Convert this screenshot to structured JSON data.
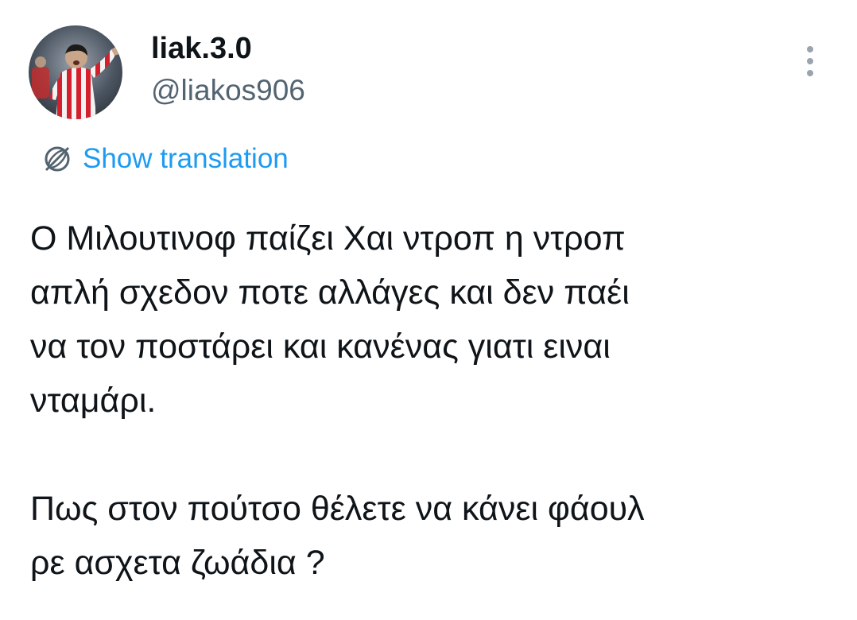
{
  "author": {
    "display_name": "liak.3.0",
    "handle": "@liakos906",
    "avatar_icon": "profile-photo-footballer-red-white-stripes"
  },
  "actions": {
    "more_icon": "vertical-ellipsis-icon"
  },
  "translation": {
    "label": "Show translation",
    "icon": "translate-globe-icon"
  },
  "tweet": {
    "text": "Ο Μιλουτινοφ παίζει Χαι ντροπ η ντροπ\nαπλή σχεδον ποτε αλλάγες και δεν παέι\nνα τον ποστάρει και κανένας γιατι ειναι\nνταμάρι.\n\nΠως στον πούτσο θέλετε να κάνει φάουλ\nρε ασχετα ζωάδια ?"
  },
  "colors": {
    "text_primary": "#0f1419",
    "text_secondary": "#536471",
    "link": "#1d9bf0",
    "background": "#ffffff"
  }
}
